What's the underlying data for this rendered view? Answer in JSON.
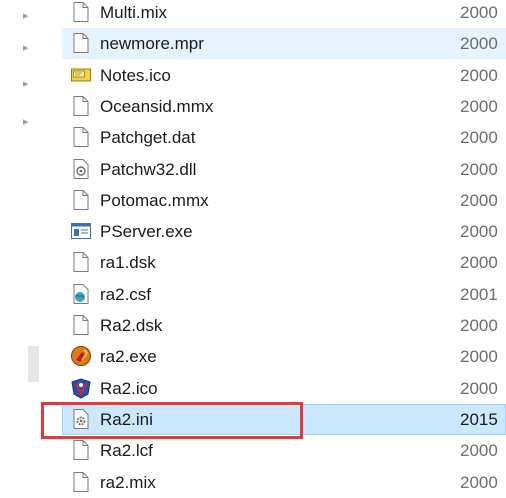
{
  "files": [
    {
      "name": "Multi.mix",
      "date": "2000",
      "icon": "blank-file-icon",
      "state": "normal"
    },
    {
      "name": "newmore.mpr",
      "date": "2000",
      "icon": "blank-file-icon",
      "state": "hover"
    },
    {
      "name": "Notes.ico",
      "date": "2000",
      "icon": "icon-file-icon",
      "state": "normal"
    },
    {
      "name": "Oceansid.mmx",
      "date": "2000",
      "icon": "blank-file-icon",
      "state": "normal"
    },
    {
      "name": "Patchget.dat",
      "date": "2000",
      "icon": "blank-file-icon",
      "state": "normal"
    },
    {
      "name": "Patchw32.dll",
      "date": "2000",
      "icon": "gear-file-icon",
      "state": "normal"
    },
    {
      "name": "Potomac.mmx",
      "date": "2000",
      "icon": "blank-file-icon",
      "state": "normal"
    },
    {
      "name": "PServer.exe",
      "date": "2000",
      "icon": "window-app-icon",
      "state": "normal"
    },
    {
      "name": "ra1.dsk",
      "date": "2000",
      "icon": "blank-file-icon",
      "state": "normal"
    },
    {
      "name": "ra2.csf",
      "date": "2001",
      "icon": "globe-file-icon",
      "state": "normal"
    },
    {
      "name": "Ra2.dsk",
      "date": "2000",
      "icon": "blank-file-icon",
      "state": "normal"
    },
    {
      "name": "ra2.exe",
      "date": "2000",
      "icon": "soviet-emblem-icon",
      "state": "normal"
    },
    {
      "name": "Ra2.ico",
      "date": "2000",
      "icon": "allied-emblem-icon",
      "state": "normal"
    },
    {
      "name": "Ra2.ini",
      "date": "2015",
      "icon": "settings-file-icon",
      "state": "selected"
    },
    {
      "name": "Ra2.lcf",
      "date": "2000",
      "icon": "blank-file-icon",
      "state": "normal"
    },
    {
      "name": "ra2.mix",
      "date": "2000",
      "icon": "blank-file-icon",
      "state": "normal"
    }
  ],
  "colors": {
    "selection": "#cce8ff",
    "hover": "#e5f3ff",
    "highlight_box": "#e23a3a"
  }
}
